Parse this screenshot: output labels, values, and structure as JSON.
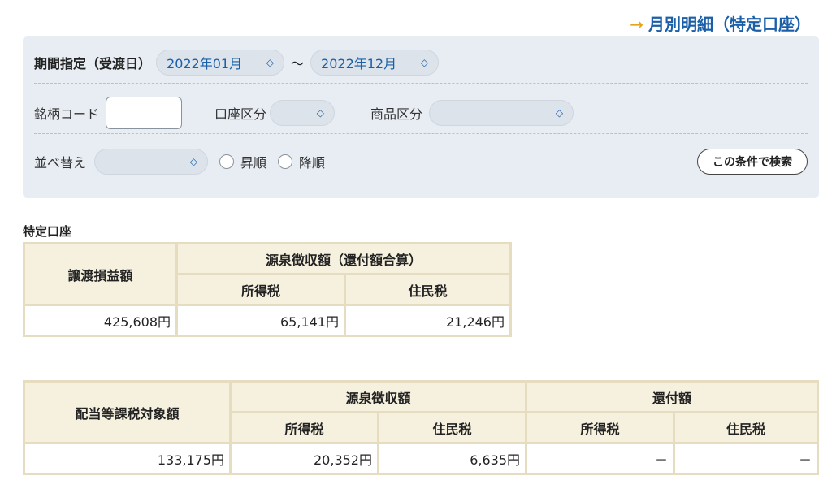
{
  "monthly_link": {
    "arrow": "→",
    "label": "月別明細（特定口座）"
  },
  "filter": {
    "period_label": "期間指定（受渡日）",
    "start_month": "2022年01月",
    "tilde": "〜",
    "end_month": "2022年12月",
    "code_label": "銘柄コード",
    "code_value": "",
    "account_label": "口座区分",
    "account_value": "",
    "product_label": "商品区分",
    "product_value": "",
    "sort_label": "並べ替え",
    "sort_value": "",
    "asc_label": "昇順",
    "desc_label": "降順",
    "search_button": "この条件で検索"
  },
  "section_title": "特定口座",
  "table1": {
    "col_transfer": "譲渡損益額",
    "group_withholding": "源泉徴収額（還付額合算）",
    "col_income_tax": "所得税",
    "col_resident_tax": "住民税",
    "row": {
      "transfer": "425,608円",
      "income_tax": "65,141円",
      "resident_tax": "21,246円"
    }
  },
  "table2": {
    "col_dividend": "配当等課税対象額",
    "group_withholding": "源泉徴収額",
    "group_refund": "還付額",
    "col_w_income_tax": "所得税",
    "col_w_resident_tax": "住民税",
    "col_r_income_tax": "所得税",
    "col_r_resident_tax": "住民税",
    "row": {
      "dividend": "133,175円",
      "w_income_tax": "20,352円",
      "w_resident_tax": "6,635円",
      "r_income_tax": "－",
      "r_resident_tax": "－"
    }
  }
}
